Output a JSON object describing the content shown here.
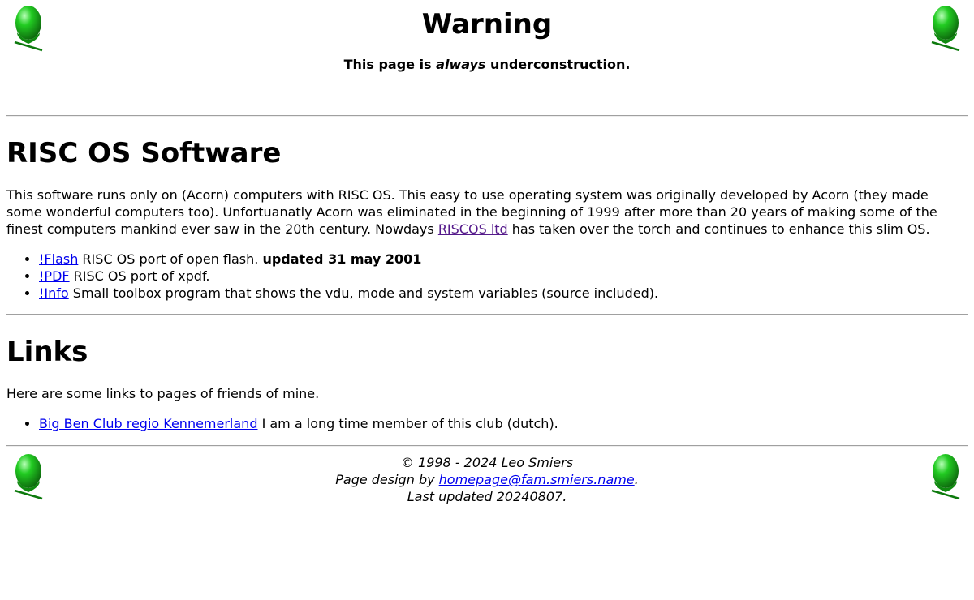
{
  "header": {
    "title": "Warning",
    "notice_prefix": "This page is ",
    "notice_emphasis": "always",
    "notice_suffix": " underconstruction.",
    "icon": "acorn-icon"
  },
  "software": {
    "heading": "RISC OS Software",
    "intro_before_link": "This software runs only on (Acorn) computers with RISC OS. This easy to use operating system was originally developed by Acorn (they made some wonderful computers too). Unfortuanatly Acorn was eliminated in the beginning of 1999 after more than 20 years of making some of the finest computers mankind ever saw in the 20th century. Nowdays ",
    "intro_link": "RISCOS ltd",
    "intro_after_link": " has taken over the torch and continues to enhance this slim OS.",
    "items": [
      {
        "link": "!Flash",
        "text": " RISC OS port of open flash. ",
        "bold": "updated 31 may 2001"
      },
      {
        "link": "!PDF",
        "text": " RISC OS port of xpdf.",
        "bold": ""
      },
      {
        "link": "!Info",
        "text": " Small toolbox program that shows the vdu, mode and system variables (source included).",
        "bold": ""
      }
    ]
  },
  "links": {
    "heading": "Links",
    "intro": "Here are some links to pages of friends of mine.",
    "items": [
      {
        "link": "Big Ben Club regio Kennemerland",
        "text": " I am a long time member of this club (dutch)."
      }
    ]
  },
  "footer": {
    "copyright": "© 1998 - 2024 Leo Smiers",
    "design_prefix": "Page design by ",
    "design_link": "homepage@fam.smiers.name",
    "design_suffix": ".",
    "last_updated": "Last updated 20240807."
  },
  "colors": {
    "link": "#0000ee",
    "visited_link": "#551a8b",
    "acorn_green": "#1aa51a",
    "divider": "#a0a0a0"
  }
}
